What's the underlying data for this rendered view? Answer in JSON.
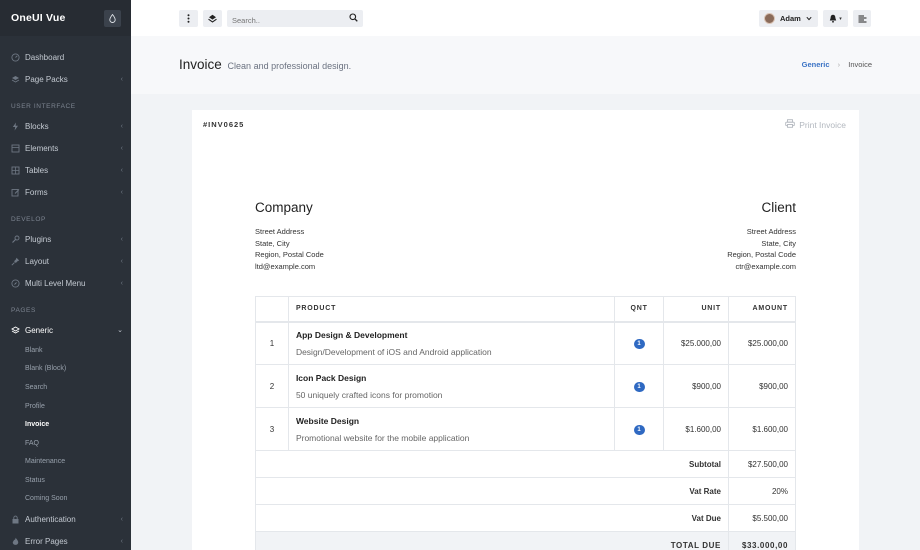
{
  "app": {
    "brand": "OneUI Vue"
  },
  "sidebar": {
    "items": [
      {
        "label": "Dashboard"
      },
      {
        "label": "Page Packs"
      },
      {
        "label": "Blocks"
      },
      {
        "label": "Elements"
      },
      {
        "label": "Tables"
      },
      {
        "label": "Forms"
      },
      {
        "label": "Plugins"
      },
      {
        "label": "Layout"
      },
      {
        "label": "Multi Level Menu"
      },
      {
        "label": "Generic"
      },
      {
        "label": "Authentication"
      },
      {
        "label": "Error Pages"
      }
    ],
    "sections": [
      "USER INTERFACE",
      "DEVELOP",
      "PAGES"
    ],
    "generic_sub": [
      "Blank",
      "Blank (Block)",
      "Search",
      "Profile",
      "Invoice",
      "FAQ",
      "Maintenance",
      "Status",
      "Coming Soon"
    ]
  },
  "header": {
    "search_placeholder": "Search..",
    "user_name": "Adam"
  },
  "hero": {
    "title": "Invoice",
    "subtitle": "Clean and professional design.",
    "breadcrumb": [
      "Generic",
      "Invoice"
    ]
  },
  "invoice": {
    "number": "#INV0625",
    "print_label": "Print Invoice",
    "company": {
      "name": "Company",
      "lines": [
        "Street Address",
        "State, City",
        "Region, Postal Code",
        "ltd@example.com"
      ]
    },
    "client": {
      "name": "Client",
      "lines": [
        "Street Address",
        "State, City",
        "Region, Postal Code",
        "ctr@example.com"
      ]
    },
    "columns": [
      "PRODUCT",
      "QNT",
      "UNIT",
      "AMOUNT"
    ],
    "rows": [
      {
        "num": "1",
        "name": "App Design & Development",
        "desc": "Design/Development of iOS and Android application",
        "qty": "1",
        "unit": "$25.000,00",
        "amount": "$25.000,00"
      },
      {
        "num": "2",
        "name": "Icon Pack Design",
        "desc": "50 uniquely crafted icons for promotion",
        "qty": "1",
        "unit": "$900,00",
        "amount": "$900,00"
      },
      {
        "num": "3",
        "name": "Website Design",
        "desc": "Promotional website for the mobile application",
        "qty": "1",
        "unit": "$1.600,00",
        "amount": "$1.600,00"
      }
    ],
    "summary": [
      {
        "label": "Subtotal",
        "value": "$27.500,00"
      },
      {
        "label": "Vat Rate",
        "value": "20%"
      },
      {
        "label": "Vat Due",
        "value": "$5.500,00"
      },
      {
        "label": "TOTAL DUE",
        "value": "$33.000,00"
      }
    ]
  }
}
